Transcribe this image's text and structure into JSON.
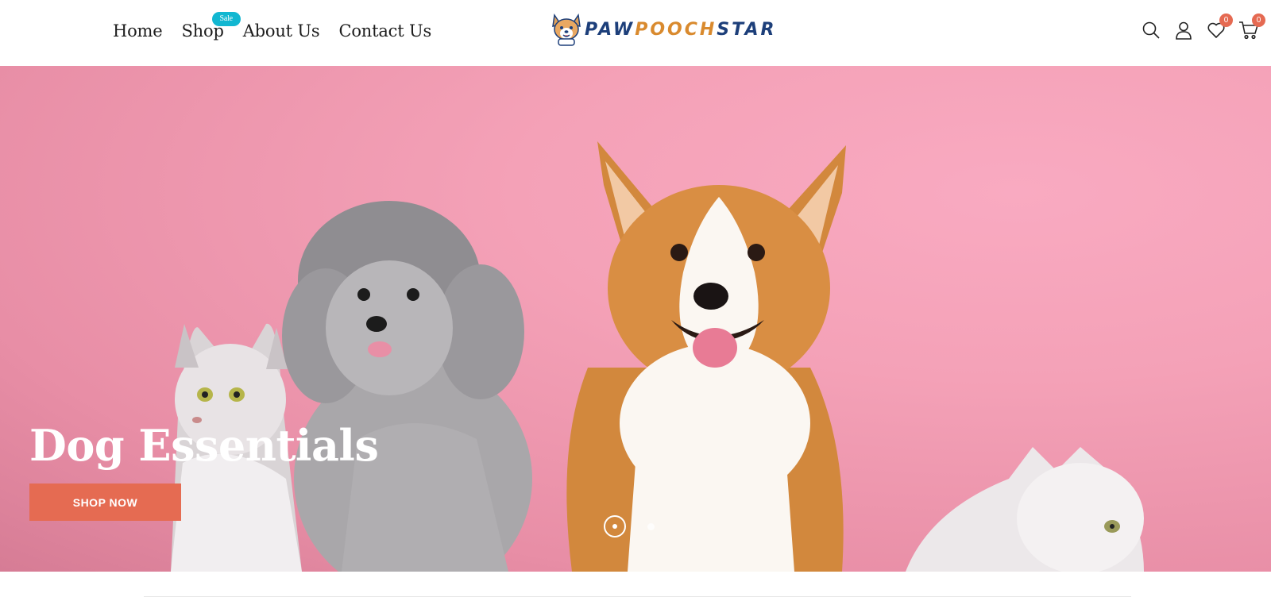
{
  "header": {
    "nav": [
      {
        "label": "Home"
      },
      {
        "label": "Shop",
        "badge": "Sale"
      },
      {
        "label": "About Us"
      },
      {
        "label": "Contact Us"
      }
    ],
    "logo": {
      "part1": "PAW",
      "part2": "POOCH",
      "part3": "STAR"
    },
    "icons": {
      "search": "search-icon",
      "account": "user-icon",
      "wishlist": "heart-icon",
      "cart": "cart-icon"
    },
    "wishlist_count": "0",
    "cart_count": "0"
  },
  "hero": {
    "title": "Dog Essentials",
    "button_label": "SHOP NOW",
    "slides_total": 2,
    "active_slide": 1
  },
  "colors": {
    "accent": "#e56b52",
    "badge": "#12b7d1",
    "hero_background": "#f4a1b7",
    "logo_blue": "#1d3f7a",
    "logo_orange": "#d98a2e"
  }
}
